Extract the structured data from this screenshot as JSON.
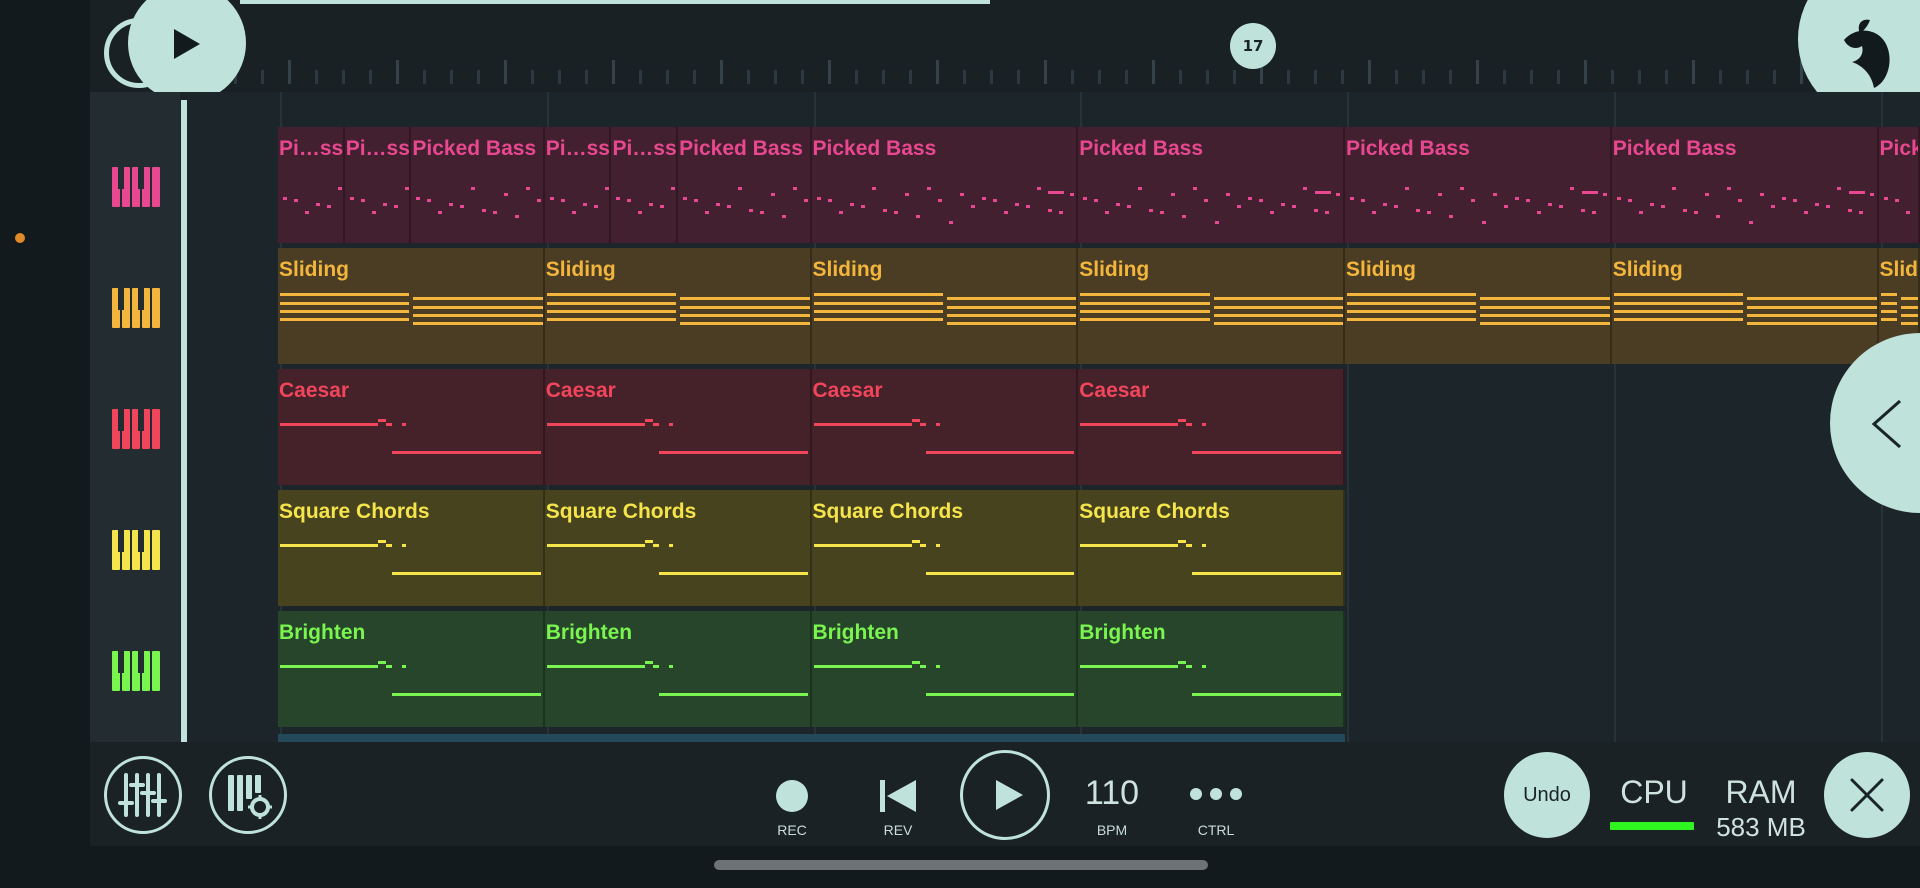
{
  "transport": {
    "loop_marker": "17",
    "rec_label": "REC",
    "rev_label": "REV",
    "bpm_value": "110",
    "bpm_label": "BPM",
    "ctrl_label": "CTRL",
    "undo_label": "Undo",
    "cpu_label": "CPU",
    "ram_label": "RAM",
    "ram_value": "583 MB"
  },
  "tracks": [
    {
      "name": "Picked Bass",
      "color": "#e8488f",
      "bg": "#43202f",
      "clips": [
        {
          "label": "Pi…ss"
        },
        {
          "label": "Pi…ss"
        },
        {
          "label": "Picked Bass"
        },
        {
          "label": "Pi…ss"
        },
        {
          "label": "Pi…ss"
        },
        {
          "label": "Picked Bass"
        },
        {
          "label": "Picked Bass"
        },
        {
          "label": "Picked Bass"
        },
        {
          "label": "Picked Bass"
        },
        {
          "label": "Picked Bass"
        },
        {
          "label": "Picked Bass"
        }
      ]
    },
    {
      "name": "Sliding",
      "color": "#f3b53c",
      "bg": "#4a3d23",
      "clips": [
        {
          "label": "Sliding"
        },
        {
          "label": "Sliding"
        },
        {
          "label": "Sliding"
        },
        {
          "label": "Sliding"
        },
        {
          "label": "Sliding"
        },
        {
          "label": "Sliding"
        },
        {
          "label": "Sliding"
        }
      ]
    },
    {
      "name": "Caesar",
      "color": "#f0455b",
      "bg": "#45222a",
      "clips": [
        {
          "label": "Caesar"
        },
        {
          "label": "Caesar"
        },
        {
          "label": "Caesar"
        },
        {
          "label": "Caesar"
        }
      ]
    },
    {
      "name": "Square Chords",
      "color": "#f5e44a",
      "bg": "#47431f",
      "clips": [
        {
          "label": "Square Chords"
        },
        {
          "label": "Square Chords"
        },
        {
          "label": "Square Chords"
        },
        {
          "label": "Square Chords"
        }
      ]
    },
    {
      "name": "Brighten",
      "color": "#7af550",
      "bg": "#27452a",
      "clips": [
        {
          "label": "Brighten"
        },
        {
          "label": "Brighten"
        },
        {
          "label": "Brighten"
        },
        {
          "label": "Brighten"
        }
      ]
    }
  ]
}
